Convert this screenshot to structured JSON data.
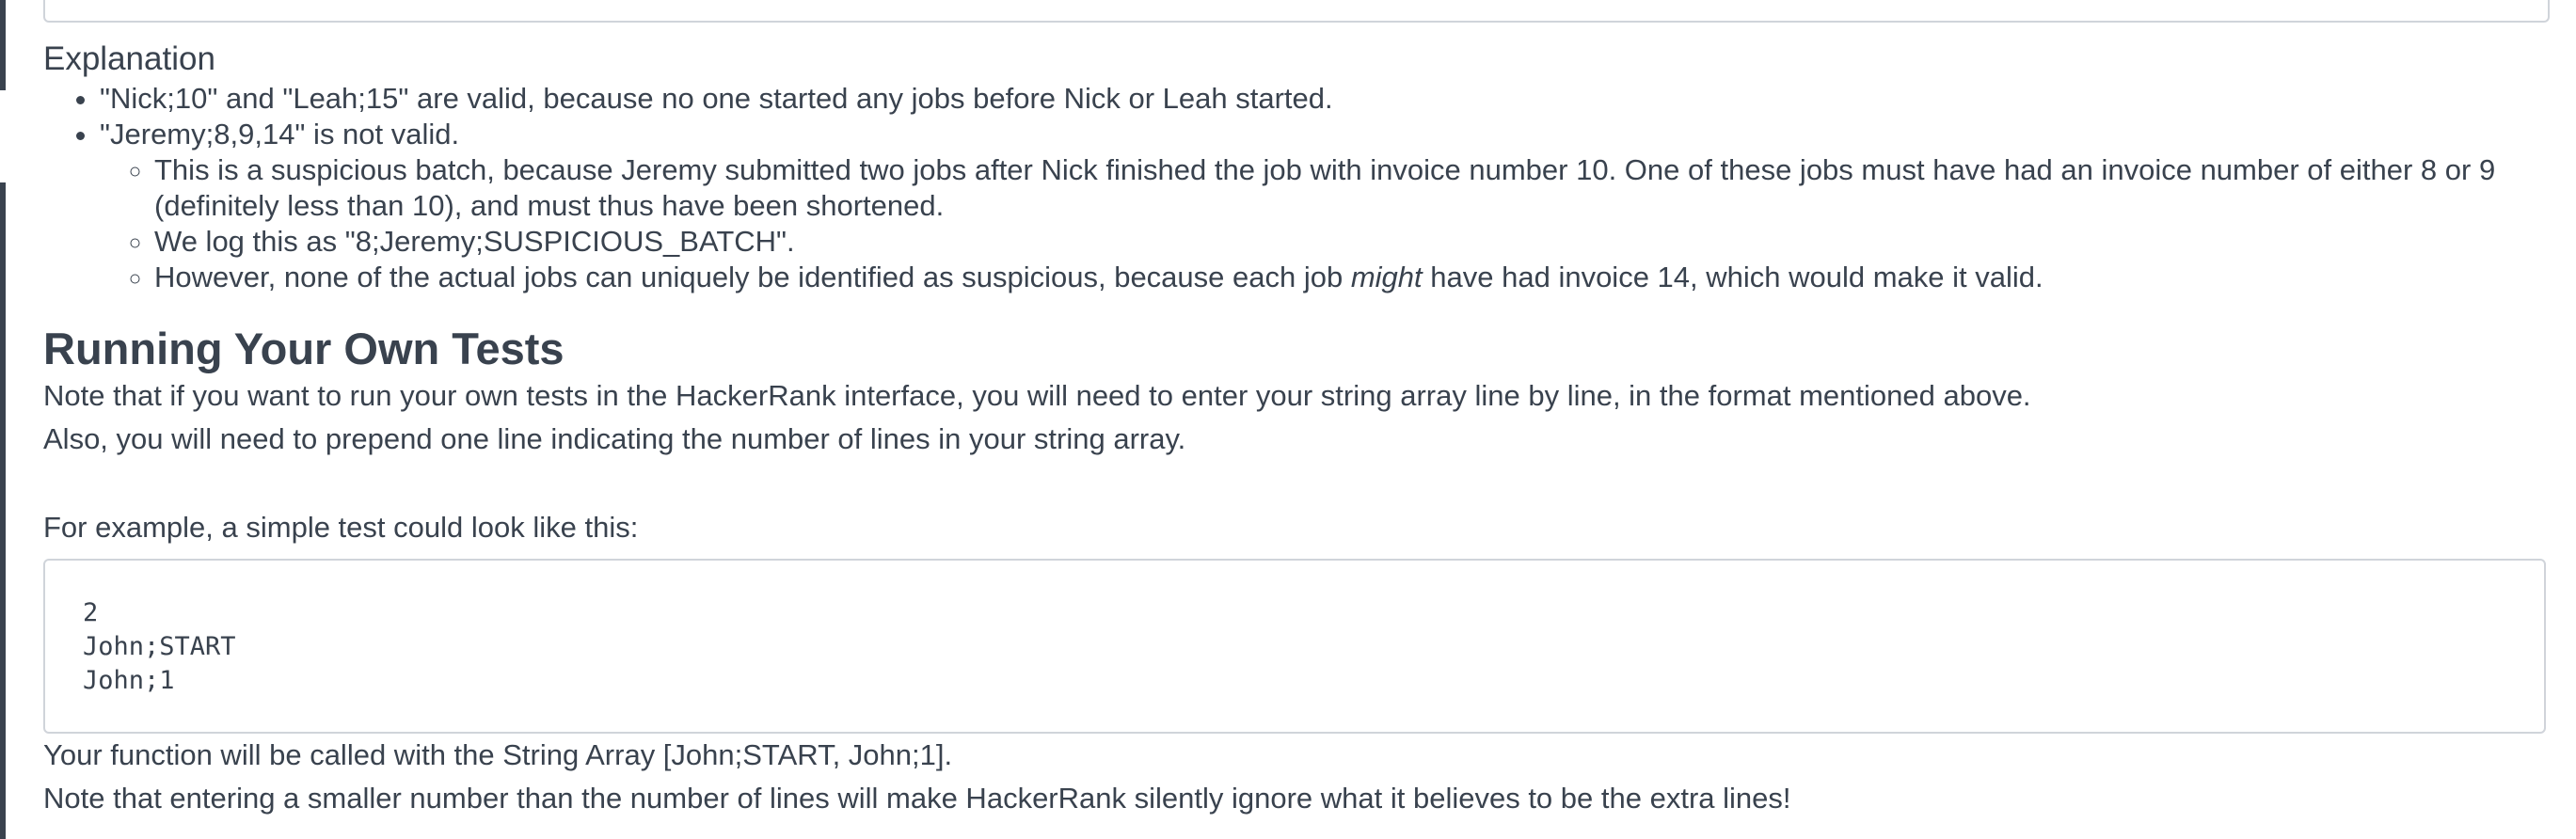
{
  "explanation": {
    "title": "Explanation",
    "bullets": [
      "\"Nick;10\" and \"Leah;15\" are valid, because no one started any jobs before Nick or Leah started.",
      "\"Jeremy;8,9,14\" is not valid."
    ],
    "sub_bullets": [
      "This is a suspicious batch, because Jeremy submitted two jobs after Nick finished the job with invoice number 10. One of these jobs must have had an invoice number of either 8 or 9 (definitely less than 10), and must thus have been shortened.",
      "We log this as \"8;Jeremy;SUSPICIOUS_BATCH\".",
      {
        "before": "However, none of the actual jobs can uniquely be identified as suspicious, because each job ",
        "emphasis": "might",
        "after": " have had invoice 14, which would make it valid."
      }
    ]
  },
  "running_tests": {
    "title": "Running Your Own Tests",
    "para1": "Note that if you want to run your own tests in the HackerRank interface, you will need to enter your string array line by line, in the format mentioned above.",
    "para2": "Also, you will need to prepend one line indicating the number of lines in your string array.",
    "para3": "For example, a simple test could look like this:",
    "code_lines": [
      "2",
      "John;START",
      "John;1"
    ],
    "para4": "Your function will be called with the String Array [John;START, John;1].",
    "para5": "Note that entering a smaller number than the number of lines will make HackerRank silently ignore what it believes to be the extra lines!"
  },
  "colors": {
    "text": "#39424e",
    "border": "#d0d4da",
    "accent_bar": "#39424e"
  }
}
